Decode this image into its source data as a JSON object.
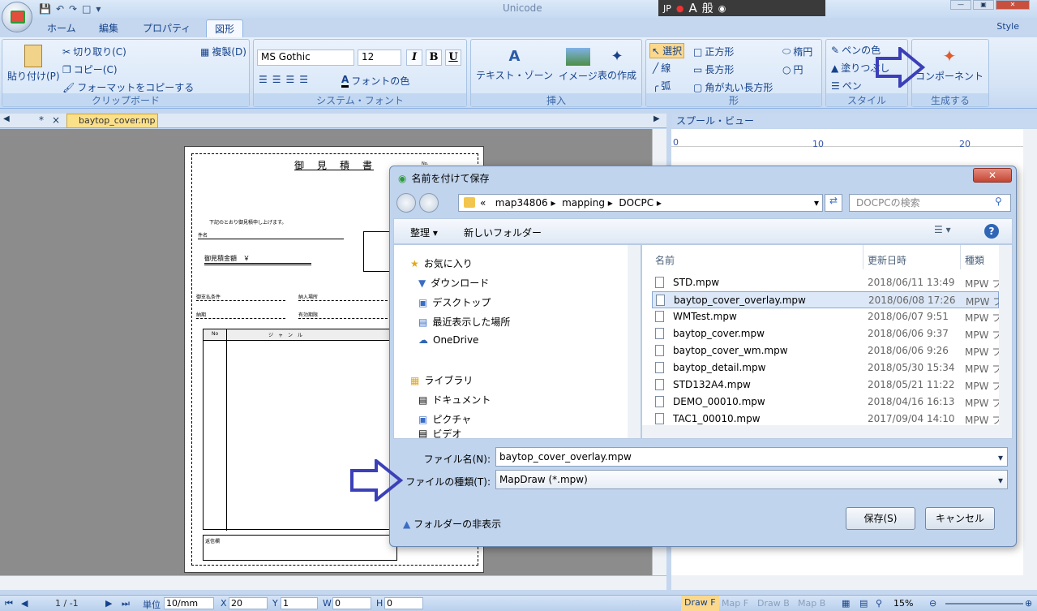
{
  "app": {
    "title": "Unicode",
    "ime": [
      "JP",
      "A",
      "般"
    ],
    "style_menu": "Style"
  },
  "ribbon_tabs": [
    "ホーム",
    "編集",
    "プロパティ",
    "図形"
  ],
  "ribbon": {
    "clipboard": {
      "paste": "貼り付け(P)",
      "cut": "切り取り(C)",
      "copy": "コピー(C)",
      "format_copy": "フォーマットをコピーする",
      "duplicate": "複製(D)",
      "label": "クリップボード"
    },
    "font": {
      "family": "MS Gothic",
      "size": "12",
      "italic": "I",
      "bold": "B",
      "underline": "U",
      "font_color": "フォントの色",
      "label": "システム・フォント"
    },
    "insert": {
      "textzone": "テキスト・ゾーン",
      "image": "イメージ",
      "table": "表の作成",
      "label": "挿入"
    },
    "shape": {
      "select": "選択",
      "line": "線",
      "arc": "弧",
      "square": "正方形",
      "rect": "長方形",
      "rounded": "角が丸い長方形",
      "ellipse": "楕円",
      "circle": "円",
      "label": "形"
    },
    "style": {
      "pen_color": "ペンの色",
      "fill": "塗りつぶし",
      "pen": "ペン",
      "label": "スタイル"
    },
    "generate": {
      "component": "コンポーネント",
      "label": "生成する"
    }
  },
  "doc_tabs": {
    "star": "*",
    "close": "×",
    "active": "baytop_cover.mp"
  },
  "spool": {
    "title": "スプール・ビュー",
    "ruler": [
      "0",
      "10",
      "20"
    ]
  },
  "paper": {
    "title": "御　見　積　書",
    "line1": "下記のとおり御見積申し上げます。",
    "subject": "件名",
    "amount": "御見積金額　￥",
    "cond1": "御支払条件",
    "cond2": "納入場所",
    "cond3": "納期",
    "cond4": "有効期限",
    "table_no": "No",
    "table_genre": "ジ　ャ　ン　ル",
    "remarks": "返信欄",
    "no_label": "No."
  },
  "dialog": {
    "title": "名前を付けて保存",
    "path": [
      "«",
      "map34806",
      "mapping",
      "DOCPC"
    ],
    "search_placeholder": "DOCPCの検索",
    "organize": "整理",
    "new_folder": "新しいフォルダー",
    "nav": [
      "お気に入り",
      "ダウンロード",
      "デスクトップ",
      "最近表示した場所",
      "OneDrive",
      "ライブラリ",
      "ドキュメント",
      "ピクチャ",
      "ビデオ"
    ],
    "columns": {
      "name": "名前",
      "date": "更新日時",
      "type": "種類"
    },
    "files": [
      {
        "name": "STD.mpw",
        "date": "2018/06/11 13:49",
        "type": "MPW フ"
      },
      {
        "name": "baytop_cover_overlay.mpw",
        "date": "2018/06/08 17:26",
        "type": "MPW フ"
      },
      {
        "name": "WMTest.mpw",
        "date": "2018/06/07 9:51",
        "type": "MPW フ"
      },
      {
        "name": "baytop_cover.mpw",
        "date": "2018/06/06 9:37",
        "type": "MPW フ"
      },
      {
        "name": "baytop_cover_wm.mpw",
        "date": "2018/06/06 9:26",
        "type": "MPW フ"
      },
      {
        "name": "baytop_detail.mpw",
        "date": "2018/05/30 15:34",
        "type": "MPW フ"
      },
      {
        "name": "STD132A4.mpw",
        "date": "2018/05/21 11:22",
        "type": "MPW フ"
      },
      {
        "name": "DEMO_00010.mpw",
        "date": "2018/04/16 16:13",
        "type": "MPW フ"
      },
      {
        "name": "TAC1_00010.mpw",
        "date": "2017/09/04 14:10",
        "type": "MPW フ"
      }
    ],
    "filename_label": "ファイル名(N):",
    "filename_value": "baytop_cover_overlay.mpw",
    "filetype_label": "ファイルの種類(T):",
    "filetype_value": "MapDraw (*.mpw)",
    "hide_folders": "フォルダーの非表示",
    "save": "保存(S)",
    "cancel": "キャンセル"
  },
  "status": {
    "page": "1 / -1",
    "unit_label": "単位",
    "unit_value": "10/mm",
    "x_label": "X",
    "x_value": "20",
    "y_label": "Y",
    "y_value": "1",
    "w_label": "W",
    "w_value": "0",
    "h_label": "H",
    "h_value": "0",
    "tabs": [
      "Draw F",
      "Map F",
      "Draw B",
      "Map B"
    ],
    "zoom": "15%"
  },
  "colors": {
    "accent": "#15428b",
    "arrow": "#3b40b8",
    "selected_tab": "#fbe08a"
  }
}
